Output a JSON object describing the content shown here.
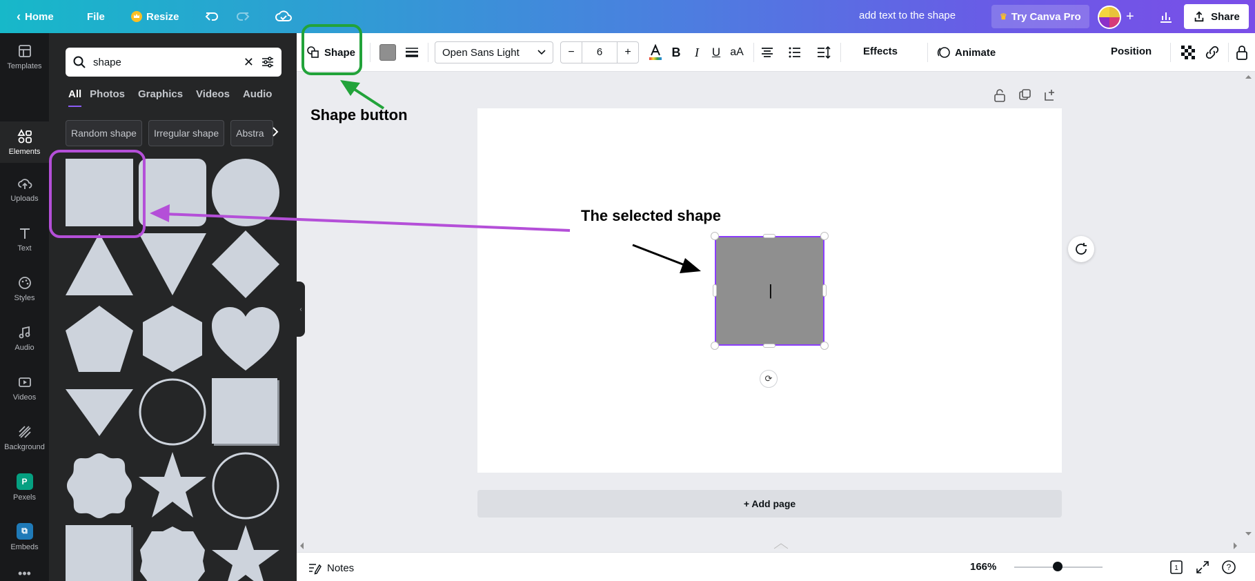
{
  "topbar": {
    "home_label": "Home",
    "file_label": "File",
    "resize_label": "Resize",
    "doc_title": "add text to the shape",
    "try_pro_label": "Try Canva Pro",
    "share_label": "Share"
  },
  "rail": {
    "items": [
      {
        "label": "Templates",
        "icon": "templates-icon"
      },
      {
        "label": "Elements",
        "icon": "elements-icon"
      },
      {
        "label": "Uploads",
        "icon": "uploads-icon"
      },
      {
        "label": "Text",
        "icon": "text-icon"
      },
      {
        "label": "Styles",
        "icon": "styles-icon"
      },
      {
        "label": "Audio",
        "icon": "audio-icon"
      },
      {
        "label": "Videos",
        "icon": "videos-icon"
      },
      {
        "label": "Background",
        "icon": "background-icon"
      },
      {
        "label": "Pexels",
        "icon": "pexels-icon"
      },
      {
        "label": "Embeds",
        "icon": "embeds-icon"
      },
      {
        "label": "More",
        "icon": "more-icon"
      }
    ]
  },
  "panel": {
    "search_value": "shape",
    "tabs": [
      "All",
      "Photos",
      "Graphics",
      "Videos",
      "Audio"
    ],
    "chips": [
      "Random shape",
      "Irregular shape",
      "Abstra"
    ]
  },
  "toolbar": {
    "shape_label": "Shape",
    "font_name": "Open Sans Light",
    "font_size": "6",
    "minus": "−",
    "plus": "+",
    "effects_label": "Effects",
    "animate_label": "Animate",
    "position_label": "Position"
  },
  "canvas": {
    "add_page_label": "+ Add page",
    "cursor_glyph": "|"
  },
  "bottombar": {
    "notes_label": "Notes",
    "zoom_label": "166%",
    "zoom_level_percent": 166,
    "page_count": "1"
  },
  "annotations": {
    "shape_button": "Shape button",
    "selected_shape": "The selected shape"
  },
  "colors": {
    "accent_purple": "#8b3dff",
    "annotation_green": "#22a33a",
    "annotation_purple": "#b44fd8",
    "shape_fill": "#8f8f8f",
    "library_shape": "#cdd3dc"
  }
}
